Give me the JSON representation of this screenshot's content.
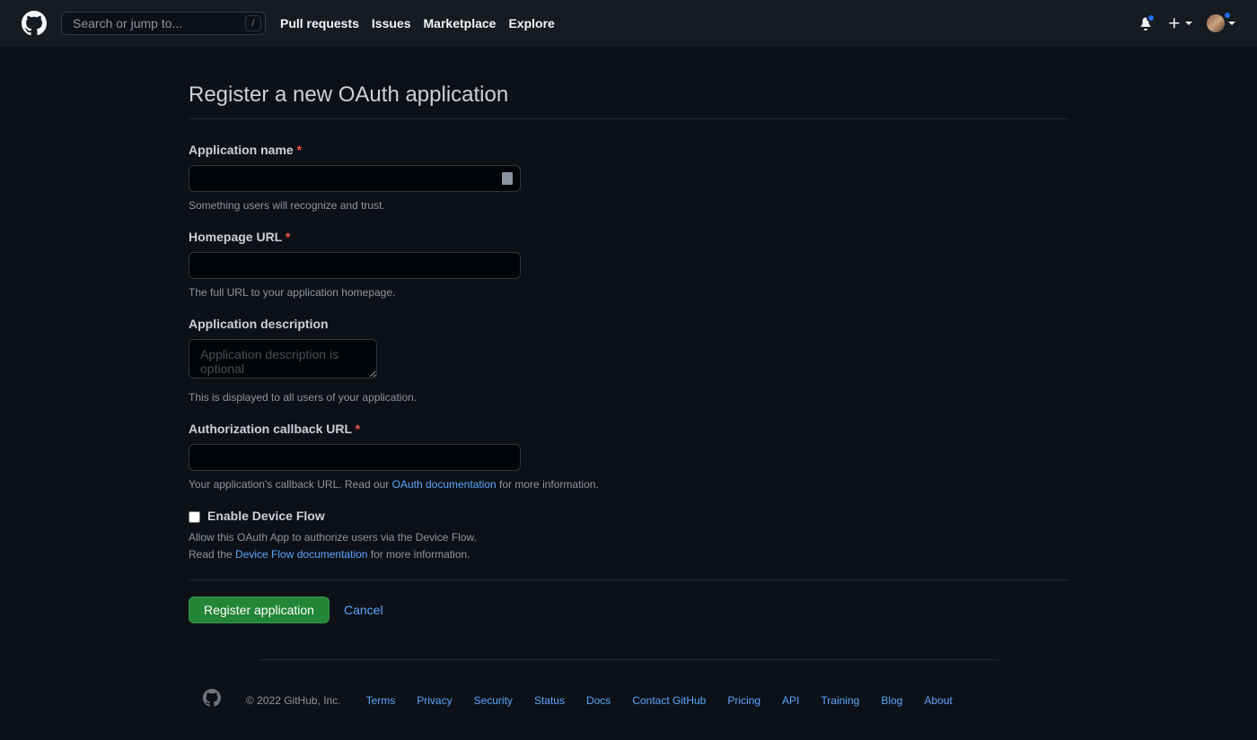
{
  "header": {
    "search_placeholder": "Search or jump to...",
    "slash": "/",
    "nav": {
      "pull_requests": "Pull requests",
      "issues": "Issues",
      "marketplace": "Marketplace",
      "explore": "Explore"
    }
  },
  "page": {
    "title": "Register a new OAuth application"
  },
  "fields": {
    "app_name": {
      "label": "Application name",
      "hint": "Something users will recognize and trust."
    },
    "homepage": {
      "label": "Homepage URL",
      "hint": "The full URL to your application homepage."
    },
    "description": {
      "label": "Application description",
      "placeholder": "Application description is optional",
      "hint": "This is displayed to all users of your application."
    },
    "callback": {
      "label": "Authorization callback URL",
      "hint_pre": "Your application's callback URL. Read our ",
      "hint_link": "OAuth documentation",
      "hint_post": " for more information."
    },
    "device_flow": {
      "label": "Enable Device Flow",
      "line1": "Allow this OAuth App to authorize users via the Device Flow.",
      "line2_pre": "Read the ",
      "line2_link": "Device Flow documentation",
      "line2_post": " for more information."
    }
  },
  "actions": {
    "submit": "Register application",
    "cancel": "Cancel"
  },
  "footer": {
    "copyright": "© 2022 GitHub, Inc.",
    "links": {
      "terms": "Terms",
      "privacy": "Privacy",
      "security": "Security",
      "status": "Status",
      "docs": "Docs",
      "contact": "Contact GitHub",
      "pricing": "Pricing",
      "api": "API",
      "training": "Training",
      "blog": "Blog",
      "about": "About"
    }
  }
}
